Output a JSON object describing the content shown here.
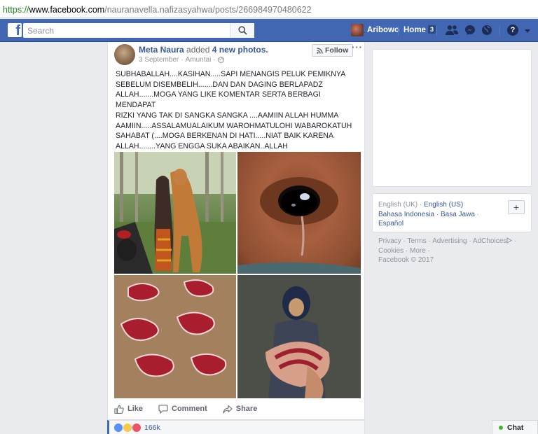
{
  "url": {
    "scheme": "https://",
    "host": "www.facebook.com",
    "path": "/nauranavella.nafizasyahwa/posts/266984970480622"
  },
  "topbar": {
    "search_placeholder": "Search",
    "user_name": "Aribowo",
    "home_label": "Home",
    "home_count": "3",
    "help_label": "?"
  },
  "post": {
    "author": "Meta Naura",
    "verb": "added",
    "object": "4 new photos.",
    "date": "3 September",
    "location": "Amuntai",
    "follow_label": "Follow",
    "more_label": "···",
    "text": "SUBHABALLAH....KASIHAN.....SAPI MENANGIS PELUK PEMIKNYA\nSEBELUM DISEMBELIH.......DAN DAN DAGING BERLAPADZ\nALLAH.......MOGA YANG LIKE KOMENTAR SERTA BERBAGI MENDAPAT\nRIZKI YANG TAK DI SANGKA SANGKA ....AAMIIN ALLAH HUMMA\nAAMIIN.....ASSALAMUALAIKUM WAROHMATULOHI WABAROKATUH\nSAHABAT (....MOGA BERKENAN DI HATI.....NIAT BAIK KARENA\nALLAH........YANG ENGGA SUKA ABAIKAN..ALLAH\nHUAKBAR.........KUASA ALLAH...",
    "actions": {
      "like": "Like",
      "comment": "Comment",
      "share": "Share"
    },
    "reaction_count": "166k"
  },
  "languages": {
    "current": "English (UK)",
    "items": [
      "English (US)",
      "Bahasa Indonesia",
      "Basa Jawa",
      "Español"
    ],
    "add_label": "+"
  },
  "footer": {
    "links": [
      "Privacy",
      "Terms",
      "Advertising",
      "AdChoices",
      "Cookies",
      "More"
    ],
    "copyright": "Facebook © 2017"
  },
  "chat": {
    "label": "Chat"
  },
  "colors": {
    "brand": "#4267b2",
    "link": "#365899",
    "online": "#42b72a"
  }
}
